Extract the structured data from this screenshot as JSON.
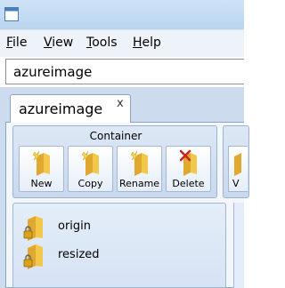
{
  "menu": {
    "file": {
      "label_first": "F",
      "label_rest": "ile"
    },
    "view": {
      "label_first": "V",
      "label_rest": "iew"
    },
    "tools": {
      "label_first": "T",
      "label_rest": "ools"
    },
    "help": {
      "label_first": "H",
      "label_rest": "elp"
    }
  },
  "address": {
    "value": "azureimage"
  },
  "tab": {
    "label": "azureimage",
    "close": "x"
  },
  "ribbon": {
    "group_title": "Container",
    "buttons": [
      {
        "label": "New",
        "icon": "folder-new-icon"
      },
      {
        "label": "Copy",
        "icon": "folder-copy-icon"
      },
      {
        "label": "Rename",
        "icon": "folder-rename-icon"
      },
      {
        "label": "Delete",
        "icon": "folder-delete-icon"
      }
    ],
    "partial_button": {
      "label": "V"
    }
  },
  "containers": [
    {
      "label": "origin",
      "icon": "locked-folder-icon"
    },
    {
      "label": "resized",
      "icon": "locked-folder-icon"
    }
  ],
  "colors": {
    "folder": "#f2c84b",
    "accent": "#b9d4ef",
    "delete_mark": "#cc2222"
  }
}
